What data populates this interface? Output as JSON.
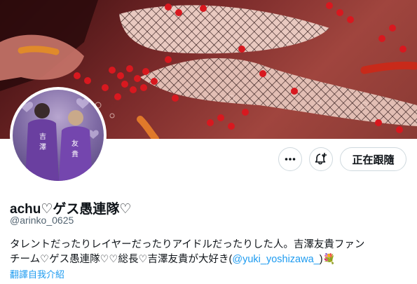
{
  "profile": {
    "display_name": "achu♡ゲス愚連隊♡",
    "handle": "@arinko_0625",
    "bio_line1": "タレントだったりレイヤーだったりアイドルだったりした人。吉澤友貴ファン",
    "bio_line2_prefix": "チーム♡ゲス愚連隊♡♡総長♡吉澤友貴が大好き(",
    "bio_mention": "@yuki_yoshizawa_",
    "bio_line2_suffix": ")💐",
    "translate_label": "翻譯自我介紹"
  },
  "actions": {
    "more_icon": "more-dots-icon",
    "bell_icon": "notification-bell-plus-icon",
    "follow_label": "正在跟隨"
  },
  "colors": {
    "link": "#1d9bf0",
    "secondary_text": "#536471",
    "border": "#cfd9de"
  }
}
